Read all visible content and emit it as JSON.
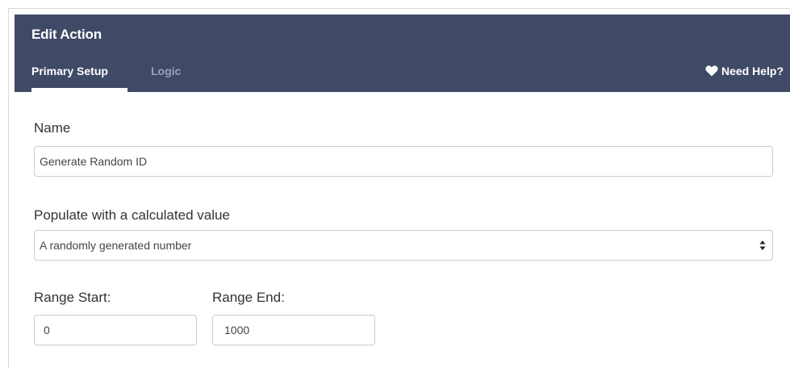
{
  "header": {
    "title": "Edit Action",
    "tabs": [
      {
        "label": "Primary Setup",
        "active": true
      },
      {
        "label": "Logic",
        "active": false
      }
    ],
    "help_label": "Need Help?",
    "help_icon": "heart-icon",
    "background_color": "#404a66"
  },
  "form": {
    "name": {
      "label": "Name",
      "value": "Generate Random ID"
    },
    "populate": {
      "label": "Populate with a calculated value",
      "selected": "A randomly generated number",
      "icon": "select-arrows-icon"
    },
    "range_start": {
      "label": "Range Start:",
      "value": "0"
    },
    "range_end": {
      "label": "Range End:",
      "value": "1000"
    }
  }
}
